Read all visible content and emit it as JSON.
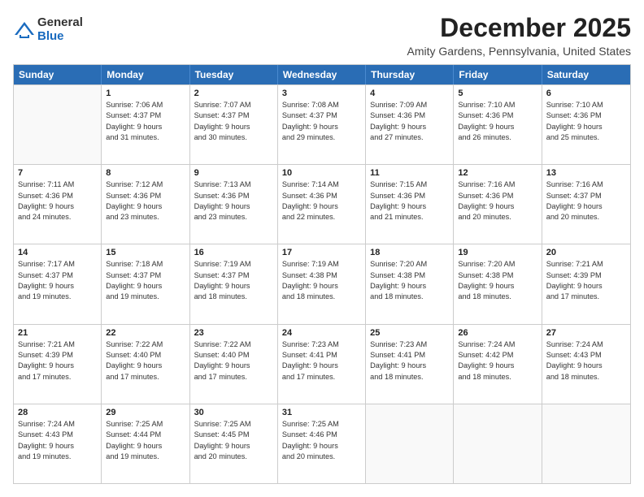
{
  "logo": {
    "general": "General",
    "blue": "Blue"
  },
  "title": "December 2025",
  "location": "Amity Gardens, Pennsylvania, United States",
  "header_days": [
    "Sunday",
    "Monday",
    "Tuesday",
    "Wednesday",
    "Thursday",
    "Friday",
    "Saturday"
  ],
  "weeks": [
    [
      {
        "day": "",
        "info": ""
      },
      {
        "day": "1",
        "info": "Sunrise: 7:06 AM\nSunset: 4:37 PM\nDaylight: 9 hours\nand 31 minutes."
      },
      {
        "day": "2",
        "info": "Sunrise: 7:07 AM\nSunset: 4:37 PM\nDaylight: 9 hours\nand 30 minutes."
      },
      {
        "day": "3",
        "info": "Sunrise: 7:08 AM\nSunset: 4:37 PM\nDaylight: 9 hours\nand 29 minutes."
      },
      {
        "day": "4",
        "info": "Sunrise: 7:09 AM\nSunset: 4:36 PM\nDaylight: 9 hours\nand 27 minutes."
      },
      {
        "day": "5",
        "info": "Sunrise: 7:10 AM\nSunset: 4:36 PM\nDaylight: 9 hours\nand 26 minutes."
      },
      {
        "day": "6",
        "info": "Sunrise: 7:10 AM\nSunset: 4:36 PM\nDaylight: 9 hours\nand 25 minutes."
      }
    ],
    [
      {
        "day": "7",
        "info": "Sunrise: 7:11 AM\nSunset: 4:36 PM\nDaylight: 9 hours\nand 24 minutes."
      },
      {
        "day": "8",
        "info": "Sunrise: 7:12 AM\nSunset: 4:36 PM\nDaylight: 9 hours\nand 23 minutes."
      },
      {
        "day": "9",
        "info": "Sunrise: 7:13 AM\nSunset: 4:36 PM\nDaylight: 9 hours\nand 23 minutes."
      },
      {
        "day": "10",
        "info": "Sunrise: 7:14 AM\nSunset: 4:36 PM\nDaylight: 9 hours\nand 22 minutes."
      },
      {
        "day": "11",
        "info": "Sunrise: 7:15 AM\nSunset: 4:36 PM\nDaylight: 9 hours\nand 21 minutes."
      },
      {
        "day": "12",
        "info": "Sunrise: 7:16 AM\nSunset: 4:36 PM\nDaylight: 9 hours\nand 20 minutes."
      },
      {
        "day": "13",
        "info": "Sunrise: 7:16 AM\nSunset: 4:37 PM\nDaylight: 9 hours\nand 20 minutes."
      }
    ],
    [
      {
        "day": "14",
        "info": "Sunrise: 7:17 AM\nSunset: 4:37 PM\nDaylight: 9 hours\nand 19 minutes."
      },
      {
        "day": "15",
        "info": "Sunrise: 7:18 AM\nSunset: 4:37 PM\nDaylight: 9 hours\nand 19 minutes."
      },
      {
        "day": "16",
        "info": "Sunrise: 7:19 AM\nSunset: 4:37 PM\nDaylight: 9 hours\nand 18 minutes."
      },
      {
        "day": "17",
        "info": "Sunrise: 7:19 AM\nSunset: 4:38 PM\nDaylight: 9 hours\nand 18 minutes."
      },
      {
        "day": "18",
        "info": "Sunrise: 7:20 AM\nSunset: 4:38 PM\nDaylight: 9 hours\nand 18 minutes."
      },
      {
        "day": "19",
        "info": "Sunrise: 7:20 AM\nSunset: 4:38 PM\nDaylight: 9 hours\nand 18 minutes."
      },
      {
        "day": "20",
        "info": "Sunrise: 7:21 AM\nSunset: 4:39 PM\nDaylight: 9 hours\nand 17 minutes."
      }
    ],
    [
      {
        "day": "21",
        "info": "Sunrise: 7:21 AM\nSunset: 4:39 PM\nDaylight: 9 hours\nand 17 minutes."
      },
      {
        "day": "22",
        "info": "Sunrise: 7:22 AM\nSunset: 4:40 PM\nDaylight: 9 hours\nand 17 minutes."
      },
      {
        "day": "23",
        "info": "Sunrise: 7:22 AM\nSunset: 4:40 PM\nDaylight: 9 hours\nand 17 minutes."
      },
      {
        "day": "24",
        "info": "Sunrise: 7:23 AM\nSunset: 4:41 PM\nDaylight: 9 hours\nand 17 minutes."
      },
      {
        "day": "25",
        "info": "Sunrise: 7:23 AM\nSunset: 4:41 PM\nDaylight: 9 hours\nand 18 minutes."
      },
      {
        "day": "26",
        "info": "Sunrise: 7:24 AM\nSunset: 4:42 PM\nDaylight: 9 hours\nand 18 minutes."
      },
      {
        "day": "27",
        "info": "Sunrise: 7:24 AM\nSunset: 4:43 PM\nDaylight: 9 hours\nand 18 minutes."
      }
    ],
    [
      {
        "day": "28",
        "info": "Sunrise: 7:24 AM\nSunset: 4:43 PM\nDaylight: 9 hours\nand 19 minutes."
      },
      {
        "day": "29",
        "info": "Sunrise: 7:25 AM\nSunset: 4:44 PM\nDaylight: 9 hours\nand 19 minutes."
      },
      {
        "day": "30",
        "info": "Sunrise: 7:25 AM\nSunset: 4:45 PM\nDaylight: 9 hours\nand 20 minutes."
      },
      {
        "day": "31",
        "info": "Sunrise: 7:25 AM\nSunset: 4:46 PM\nDaylight: 9 hours\nand 20 minutes."
      },
      {
        "day": "",
        "info": ""
      },
      {
        "day": "",
        "info": ""
      },
      {
        "day": "",
        "info": ""
      }
    ]
  ]
}
